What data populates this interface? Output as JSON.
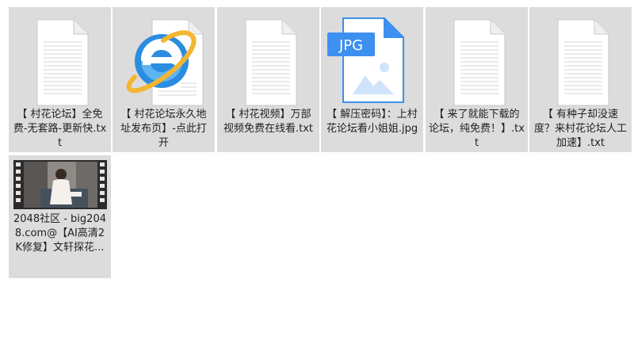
{
  "files": [
    {
      "label": "【 村花论坛】全免费-无套路-更新快.txt",
      "icon": "text-file-icon"
    },
    {
      "label": "【 村花论坛永久地址发布页】-点此打开",
      "icon": "internet-explorer-icon"
    },
    {
      "label": "【 村花视频】万部视频免费在线看.txt",
      "icon": "text-file-icon"
    },
    {
      "label": "【 解压密码】：上村花论坛看小姐姐.jpg",
      "icon": "jpg-file-icon",
      "badge": "JPG"
    },
    {
      "label": "【 来了就能下载的论坛，纯免费！】.txt",
      "icon": "text-file-icon"
    },
    {
      "label": "【 有种子却没速度？来村花论坛人工加速】.txt",
      "icon": "text-file-icon"
    },
    {
      "label": "2048社区 - big2048.com@【AI高清2K修复】文轩探花...",
      "icon": "video-thumbnail-icon"
    }
  ],
  "colors": {
    "tile_bg": "#dcdcdc",
    "jpg_blue": "#3d8ff0",
    "ie_blue": "#1e88e5",
    "ie_ring": "#f2b630"
  }
}
